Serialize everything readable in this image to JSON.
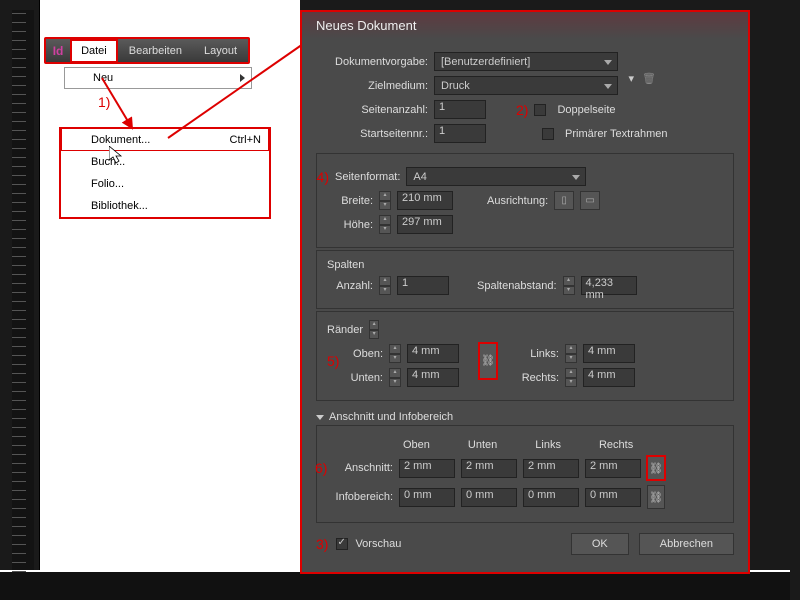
{
  "menubar": {
    "app_icon": "Id",
    "items": [
      "Datei",
      "Bearbeiten",
      "Layout"
    ],
    "neu_label": "Neu"
  },
  "annotations": {
    "a1": "1)",
    "a2": "2)",
    "a3": "3)",
    "a4": "4)",
    "a5": "5)",
    "a6": "6)"
  },
  "submenu": {
    "items": [
      {
        "label": "Dokument...",
        "shortcut": "Ctrl+N"
      },
      {
        "label": "Buch..."
      },
      {
        "label": "Folio..."
      },
      {
        "label": "Bibliothek..."
      }
    ]
  },
  "dialog": {
    "title": "Neues Dokument",
    "preset_label": "Dokumentvorgabe:",
    "preset_value": "[Benutzerdefiniert]",
    "intent_label": "Zielmedium:",
    "intent_value": "Druck",
    "pages_label": "Seitenanzahl:",
    "pages_value": "1",
    "facing_label": "Doppelseite",
    "startpage_label": "Startseitennr.:",
    "startpage_value": "1",
    "primary_label": "Primärer Textrahmen",
    "format_label": "Seitenformat:",
    "format_value": "A4",
    "width_label": "Breite:",
    "width_value": "210 mm",
    "height_label": "Höhe:",
    "height_value": "297 mm",
    "orientation_label": "Ausrichtung:",
    "columns_title": "Spalten",
    "cols_count_label": "Anzahl:",
    "cols_count_value": "1",
    "gutter_label": "Spaltenabstand:",
    "gutter_value": "4,233 mm",
    "margins_title": "Ränder",
    "top_label": "Oben:",
    "bottom_label": "Unten:",
    "left_label": "Links:",
    "right_label": "Rechts:",
    "margin_value": "4 mm",
    "bleed_title": "Anschnitt und Infobereich",
    "col_top": "Oben",
    "col_bottom": "Unten",
    "col_left": "Links",
    "col_right": "Rechts",
    "bleed_label": "Anschnitt:",
    "bleed_value": "2 mm",
    "slug_label": "Infobereich:",
    "slug_value": "0 mm",
    "preview_label": "Vorschau",
    "ok": "OK",
    "cancel": "Abbrechen"
  }
}
